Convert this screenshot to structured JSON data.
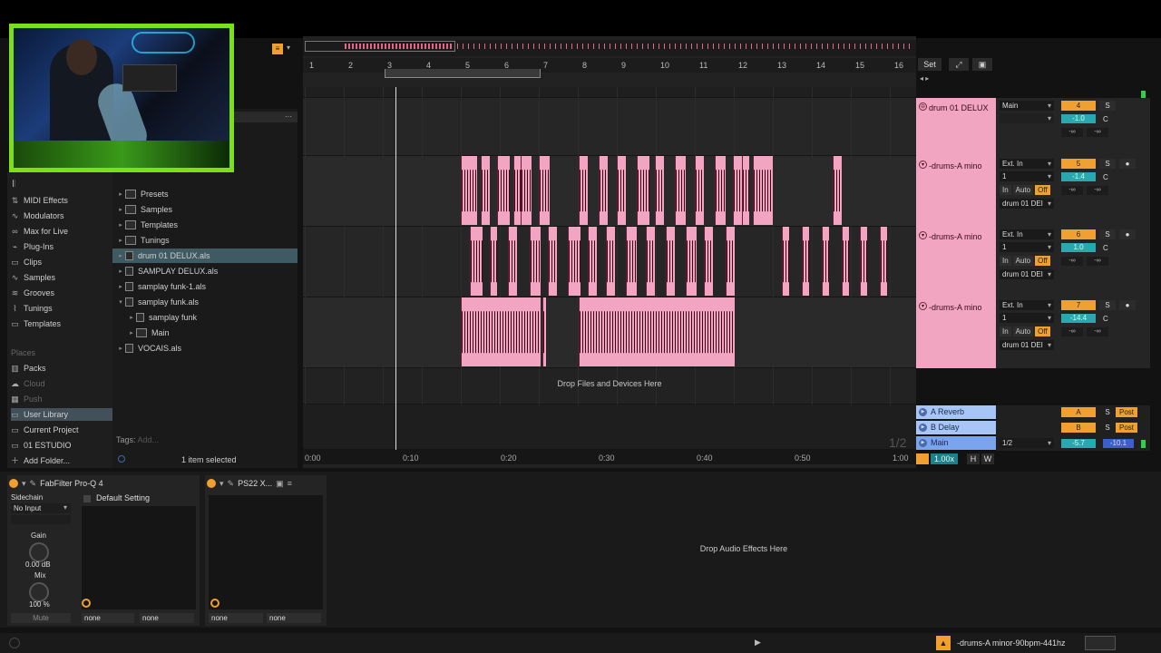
{
  "browser": {
    "categories": [
      {
        "label": "MIDI Effects",
        "icon": "midi-effects-icon"
      },
      {
        "label": "Modulators",
        "icon": "modulators-icon"
      },
      {
        "label": "Max for Live",
        "icon": "max-icon"
      },
      {
        "label": "Plug-Ins",
        "icon": "plugins-icon"
      },
      {
        "label": "Clips",
        "icon": "clips-icon"
      },
      {
        "label": "Samples",
        "icon": "samples-icon"
      },
      {
        "label": "Grooves",
        "icon": "grooves-icon"
      },
      {
        "label": "Tunings",
        "icon": "tunings-icon"
      },
      {
        "label": "Templates",
        "icon": "templates-icon"
      }
    ],
    "places_header": "Places",
    "places": [
      {
        "label": "Packs",
        "dim": false
      },
      {
        "label": "Cloud",
        "dim": true
      },
      {
        "label": "Push",
        "dim": true
      },
      {
        "label": "User Library",
        "dim": false,
        "selected": true
      },
      {
        "label": "Current Project",
        "dim": false
      },
      {
        "label": "01 ESTUDIO",
        "dim": false
      },
      {
        "label": "Add Folder...",
        "dim": false
      }
    ],
    "files": [
      {
        "label": "Presets",
        "type": "folder",
        "indent": 0
      },
      {
        "label": "Samples",
        "type": "folder",
        "indent": 0
      },
      {
        "label": "Templates",
        "type": "folder",
        "indent": 0
      },
      {
        "label": "Tunings",
        "type": "folder",
        "indent": 0
      },
      {
        "label": "drum 01 DELUX.als",
        "type": "file",
        "indent": 0,
        "selected": true
      },
      {
        "label": "SAMPLAY DELUX.als",
        "type": "file",
        "indent": 0
      },
      {
        "label": "samplay funk-1.als",
        "type": "file",
        "indent": 0
      },
      {
        "label": "samplay funk.als",
        "type": "file",
        "indent": 0,
        "open": true
      },
      {
        "label": "samplay funk",
        "type": "file",
        "indent": 1
      },
      {
        "label": "Main",
        "type": "mixer",
        "indent": 1
      },
      {
        "label": "VOCAIS.als",
        "type": "file",
        "indent": 0
      }
    ],
    "tags_label": "Tags:",
    "tags_placeholder": "Add...",
    "selection_info": "1 item selected"
  },
  "ruler": {
    "bars": [
      "1",
      "2",
      "3",
      "4",
      "5",
      "6",
      "7",
      "8",
      "9",
      "10",
      "11",
      "12",
      "13",
      "14",
      "15",
      "16"
    ],
    "time": [
      "0:00",
      "0:10",
      "0:20",
      "0:30",
      "0:40",
      "0:50",
      "1:00"
    ],
    "set_label": "Set"
  },
  "arrangement": {
    "drop_text": "Drop Files and Devices Here",
    "page_fraction": "1/2"
  },
  "tracks": [
    {
      "name": "drum 01 DELUX",
      "input": "Main",
      "number": "4",
      "volume": "-1.0",
      "pan": "C",
      "send_a": "-∞",
      "send_b": "-∞"
    },
    {
      "name": "-drums-A mino",
      "input": "Ext. In",
      "channel": "1",
      "number": "5",
      "volume": "-1.4",
      "pan": "C",
      "monitor": [
        "In",
        "Auto",
        "Off"
      ],
      "output": "drum 01 DEI",
      "send_a": "-∞",
      "send_b": "-∞"
    },
    {
      "name": "-drums-A mino",
      "input": "Ext. In",
      "channel": "1",
      "number": "6",
      "volume": "1.0",
      "pan": "C",
      "monitor": [
        "In",
        "Auto",
        "Off"
      ],
      "output": "drum 01 DEI",
      "send_a": "-∞",
      "send_b": "-∞"
    },
    {
      "name": "-drums-A mino",
      "input": "Ext. In",
      "channel": "1",
      "number": "7",
      "volume": "-14.4",
      "pan": "C",
      "monitor": [
        "In",
        "Auto",
        "Off"
      ],
      "output": "drum 01 DEI",
      "send_a": "-∞",
      "send_b": "-∞"
    }
  ],
  "returns": [
    {
      "name": "A Reverb",
      "letter": "A",
      "solo": "S",
      "post": "Post"
    },
    {
      "name": "B Delay",
      "letter": "B",
      "solo": "S",
      "post": "Post"
    },
    {
      "name": "Main",
      "io": "1/2",
      "volume": "-5.7",
      "peak": "-10.1"
    }
  ],
  "transport_small": {
    "zoom": "1.00x",
    "h": "H",
    "w": "W"
  },
  "devices": {
    "fabfilter": {
      "title": "FabFilter Pro-Q 4",
      "sidechain": "Sidechain",
      "input": "No Input",
      "gain_label": "Gain",
      "gain_value": "0.00 dB",
      "mix_label": "Mix",
      "mix_value": "100 %",
      "mute": "Mute",
      "preset": "Default Setting",
      "sel1": "none",
      "sel2": "none"
    },
    "ps22": {
      "title": "PS22 X...",
      "sel1": "none",
      "sel2": "none"
    },
    "drop_text": "Drop Audio Effects Here"
  },
  "status": {
    "text": "-drums-A minor-90bpm-441hz"
  },
  "colors": {
    "clip": "#f2a5c0",
    "accent": "#f0a030",
    "teal": "#2aa8b0",
    "return": "#a8c6f5"
  }
}
